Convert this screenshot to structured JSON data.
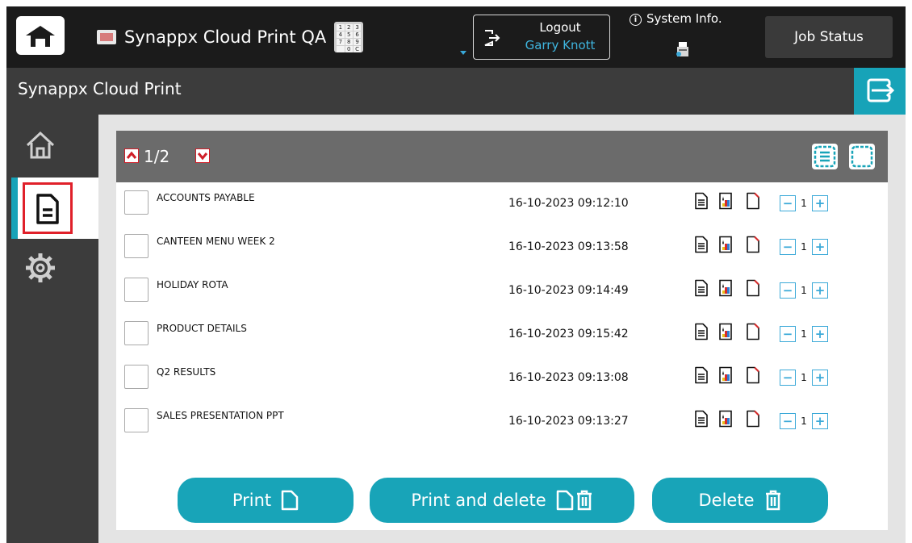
{
  "topbar": {
    "app_title": "Synappx Cloud Print QA",
    "keypad_keys": [
      "1",
      "2",
      "3",
      "4",
      "5",
      "6",
      "7",
      "8",
      "9",
      "",
      "0",
      "C"
    ],
    "logout_label": "Logout",
    "user_name": "Garry Knott",
    "system_info_label": "System Info.",
    "job_status_label": "Job Status"
  },
  "header": {
    "title": "Synappx Cloud Print"
  },
  "sidebar": {
    "items": [
      {
        "name": "home",
        "icon": "home-icon"
      },
      {
        "name": "documents",
        "icon": "document-icon",
        "active": true
      },
      {
        "name": "settings",
        "icon": "gear-icon"
      }
    ],
    "active_color": "#17a3b8",
    "highlight_color": "#e0202a"
  },
  "list": {
    "page_label": "1/2",
    "rows": [
      {
        "name": "ACCOUNTS PAYABLE",
        "date": "16-10-2023 09:12:10",
        "copies": "1"
      },
      {
        "name": "CANTEEN MENU WEEK 2",
        "date": "16-10-2023 09:13:58",
        "copies": "1"
      },
      {
        "name": "HOLIDAY ROTA",
        "date": "16-10-2023 09:14:49",
        "copies": "1"
      },
      {
        "name": "PRODUCT DETAILS",
        "date": "16-10-2023 09:15:42",
        "copies": "1"
      },
      {
        "name": "Q2 RESULTS",
        "date": "16-10-2023 09:13:08",
        "copies": "1"
      },
      {
        "name": "SALES PRESENTATION PPT",
        "date": "16-10-2023 09:13:27",
        "copies": "1"
      }
    ],
    "decrement_symbol": "−",
    "increment_symbol": "+"
  },
  "actions": {
    "print_label": "Print",
    "print_delete_label": "Print and delete",
    "delete_label": "Delete"
  },
  "colors": {
    "accent": "#18a4b8",
    "topbar": "#1b1b1b",
    "header": "#3c3c3c"
  }
}
